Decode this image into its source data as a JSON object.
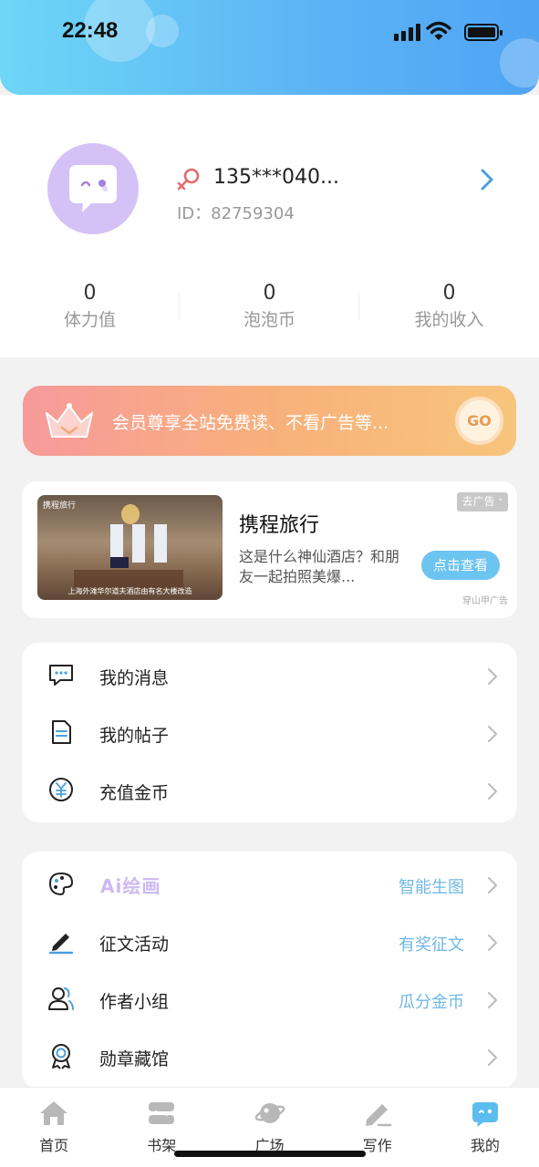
{
  "status_bar": {
    "time": "22:48"
  },
  "profile": {
    "username": "135***040...",
    "user_id": "ID：82759304",
    "stats": [
      {
        "value": "0",
        "label": "体力值"
      },
      {
        "value": "0",
        "label": "泡泡币"
      },
      {
        "value": "0",
        "label": "我的收入"
      }
    ]
  },
  "vip_banner": {
    "text": "会员尊享全站免费读、不看广告等...",
    "button": "GO"
  },
  "ad": {
    "image_brand": "携程旅行",
    "image_caption": "上海外滩华尔道夫酒店由有名大楼改造",
    "title": "携程旅行",
    "description": "这是什么神仙酒店？和朋友一起拍照美爆...",
    "tag": "去广告",
    "button": "点击查看",
    "source": "穿山甲广告"
  },
  "menu_group_1": [
    {
      "label": "我的消息",
      "icon": "message-icon"
    },
    {
      "label": "我的帖子",
      "icon": "document-icon"
    },
    {
      "label": "充值金币",
      "icon": "yuan-coin-icon"
    }
  ],
  "menu_group_2": [
    {
      "label": "Ai绘画",
      "extra": "智能生图",
      "icon": "palette-icon"
    },
    {
      "label": "征文活动",
      "extra": "有奖征文",
      "icon": "pen-icon"
    },
    {
      "label": "作者小组",
      "extra": "瓜分金币",
      "icon": "group-icon"
    },
    {
      "label": "勋章藏馆",
      "extra": "",
      "icon": "medal-icon"
    }
  ],
  "tabs": [
    {
      "label": "首页",
      "icon": "home-icon"
    },
    {
      "label": "书架",
      "icon": "bookshelf-icon"
    },
    {
      "label": "广场",
      "icon": "planet-icon"
    },
    {
      "label": "写作",
      "icon": "write-icon"
    },
    {
      "label": "我的",
      "icon": "profile-bubble-icon",
      "active": true
    }
  ],
  "colors": {
    "accent_blue": "#5bb3f5",
    "vip_orange": "#f8b07b",
    "link_blue": "#6fb8e3"
  }
}
